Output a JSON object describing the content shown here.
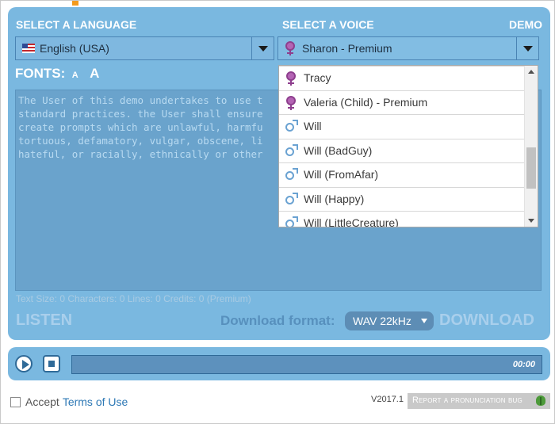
{
  "header": {
    "language_label": "SELECT A LANGUAGE",
    "voice_label": "SELECT A VOICE",
    "demo_label": "DEMO"
  },
  "language_select": {
    "value": "English (USA)",
    "flag": "us-flag-icon"
  },
  "voice_select": {
    "value": "Sharon - Premium",
    "icon": "female-icon"
  },
  "fonts": {
    "label": "FONTS:",
    "small": "A",
    "large": "A"
  },
  "textarea": {
    "lines": [
      "The User of this demo undertakes to use t",
      "standard practices. the User shall ensure",
      "create prompts which are unlawful, harmfu",
      "tortuous, defamatory, vulgar, obscene, li",
      "hateful, or racially, ethnically or other"
    ]
  },
  "status_line": "Text Size: 0 Characters: 0 Lines: 0 Credits: 0 (Premium)",
  "listen_label": "LISTEN",
  "download_format": {
    "label": "Download format:",
    "value": "WAV 22kHz"
  },
  "download_label": "DOWNLOAD",
  "player": {
    "time": "00:00"
  },
  "footer": {
    "accept_label": "Accept",
    "terms_link": "Terms of Use",
    "version": "V2017.1",
    "report_label": "Report a pronunciation bug"
  },
  "voice_dropdown": {
    "items": [
      {
        "label": "Tracy",
        "gender": "female"
      },
      {
        "label": "Valeria (Child) - Premium",
        "gender": "female"
      },
      {
        "label": "Will",
        "gender": "male"
      },
      {
        "label": "Will (BadGuy)",
        "gender": "male"
      },
      {
        "label": "Will (FromAfar)",
        "gender": "male"
      },
      {
        "label": "Will (Happy)",
        "gender": "male"
      },
      {
        "label": "Will (LittleCreature)",
        "gender": "male"
      }
    ]
  },
  "colors": {
    "panel": "#7ab8e0",
    "accent_orange": "#f39a1d",
    "link": "#2d78b5"
  }
}
